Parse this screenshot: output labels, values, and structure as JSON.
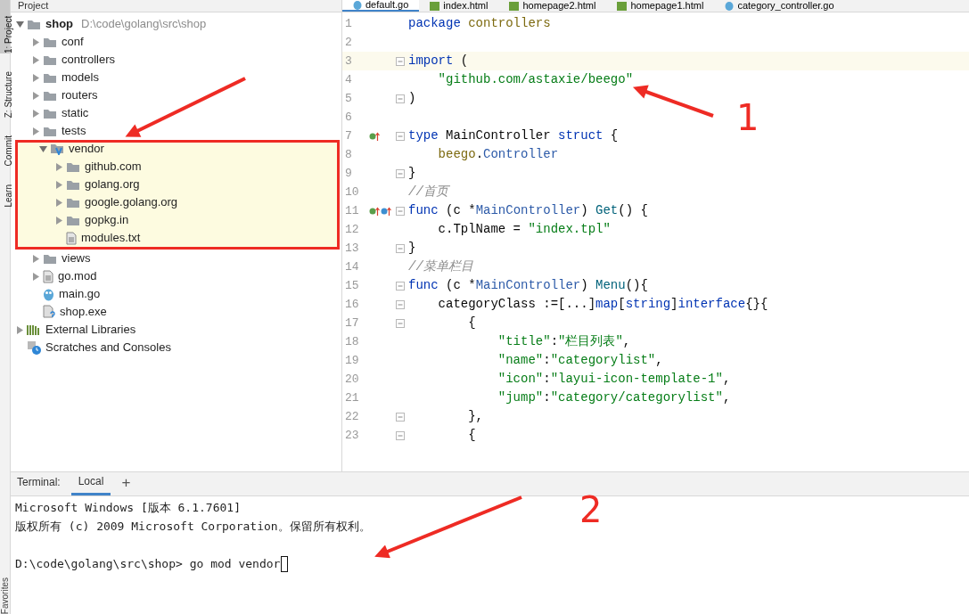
{
  "side_strip": [
    {
      "label": "1: Project",
      "selected": true
    },
    {
      "label": "Z: Structure",
      "selected": false
    },
    {
      "label": "Commit",
      "selected": false
    },
    {
      "label": "Learn",
      "selected": false
    }
  ],
  "bottom_strip": [
    {
      "label": "Favorites"
    }
  ],
  "project_panel": {
    "title": "Project"
  },
  "tree": [
    {
      "kind": "folder",
      "label": "shop",
      "path": "D:\\code\\golang\\src\\shop",
      "expanded": true,
      "children": [
        {
          "kind": "folder",
          "label": "conf",
          "expanded": false
        },
        {
          "kind": "folder",
          "label": "controllers",
          "expanded": false
        },
        {
          "kind": "folder",
          "label": "models",
          "expanded": false
        },
        {
          "kind": "folder",
          "label": "routers",
          "expanded": false
        },
        {
          "kind": "folder",
          "label": "static",
          "expanded": false
        },
        {
          "kind": "folder",
          "label": "tests",
          "expanded": false
        },
        {
          "kind": "vendor",
          "label": "vendor",
          "expanded": true,
          "annotated": true,
          "children": [
            {
              "kind": "folder",
              "label": "github.com",
              "expanded": false
            },
            {
              "kind": "folder",
              "label": "golang.org",
              "expanded": false
            },
            {
              "kind": "folder",
              "label": "google.golang.org",
              "expanded": false
            },
            {
              "kind": "folder",
              "label": "gopkg.in",
              "expanded": false
            },
            {
              "kind": "text",
              "label": "modules.txt"
            }
          ]
        },
        {
          "kind": "folder",
          "label": "views",
          "expanded": false
        },
        {
          "kind": "text",
          "label": "go.mod",
          "expanded": false
        },
        {
          "kind": "go",
          "label": "main.go"
        },
        {
          "kind": "exe",
          "label": "shop.exe"
        }
      ]
    },
    {
      "kind": "library",
      "label": "External Libraries",
      "expanded": false
    },
    {
      "kind": "scratch",
      "label": "Scratches and Consoles"
    }
  ],
  "editor_tabs": [
    {
      "kind": "go",
      "label": "default.go",
      "selected": true
    },
    {
      "kind": "html",
      "label": "index.html",
      "selected": false
    },
    {
      "kind": "html",
      "label": "homepage2.html",
      "selected": false
    },
    {
      "kind": "html",
      "label": "homepage1.html",
      "selected": false
    },
    {
      "kind": "go",
      "label": "category_controller.go",
      "selected": false
    }
  ],
  "code": [
    {
      "n": "1",
      "tokens": [
        {
          "kind": "kw",
          "text": "package"
        },
        {
          "kind": "pkg",
          "text": " controllers"
        }
      ]
    },
    {
      "n": "2"
    },
    {
      "n": "3",
      "current": true,
      "fold": true,
      "tokens": [
        {
          "kind": "kw",
          "text": "import"
        },
        {
          "kind": "plain",
          "text": " ("
        }
      ]
    },
    {
      "n": "4",
      "tokens": [
        {
          "kind": "str",
          "text": "    \"github.com/astaxie/beego\""
        }
      ]
    },
    {
      "n": "5",
      "fold": true,
      "tokens": [
        {
          "kind": "plain",
          "text": ")"
        }
      ]
    },
    {
      "n": "6"
    },
    {
      "n": "7",
      "fold": true,
      "gutter": [
        {
          "kind": "implemented"
        }
      ],
      "tokens": [
        {
          "kind": "kw",
          "text": "type"
        },
        {
          "kind": "plain",
          "text": " MainController "
        },
        {
          "kind": "kw",
          "text": "struct"
        },
        {
          "kind": "plain",
          "text": " {"
        }
      ]
    },
    {
      "n": "8",
      "tokens": [
        {
          "kind": "pkg",
          "text": "    beego"
        },
        {
          "kind": "plain",
          "text": "."
        },
        {
          "kind": "type",
          "text": "Controller"
        }
      ]
    },
    {
      "n": "9",
      "fold": true,
      "tokens": [
        {
          "kind": "plain",
          "text": "}"
        }
      ]
    },
    {
      "n": "10",
      "tokens": [
        {
          "kind": "comment",
          "text": "//首页"
        }
      ]
    },
    {
      "n": "11",
      "fold": true,
      "gutter": [
        {
          "kind": "implemented"
        },
        {
          "kind": "implementing"
        }
      ],
      "tokens": [
        {
          "kind": "kw",
          "text": "func"
        },
        {
          "kind": "plain",
          "text": " (c *"
        },
        {
          "kind": "type",
          "text": "MainController"
        },
        {
          "kind": "plain",
          "text": ") "
        },
        {
          "kind": "fn",
          "text": "Get"
        },
        {
          "kind": "plain",
          "text": "() {"
        }
      ]
    },
    {
      "n": "12",
      "tokens": [
        {
          "kind": "plain",
          "text": "    c.TplName = "
        },
        {
          "kind": "str",
          "text": "\"index.tpl\""
        }
      ]
    },
    {
      "n": "13",
      "fold": true,
      "tokens": [
        {
          "kind": "plain",
          "text": "}"
        }
      ]
    },
    {
      "n": "14",
      "tokens": [
        {
          "kind": "comment",
          "text": "//菜单栏目"
        }
      ]
    },
    {
      "n": "15",
      "fold": true,
      "tokens": [
        {
          "kind": "kw",
          "text": "func"
        },
        {
          "kind": "plain",
          "text": " (c *"
        },
        {
          "kind": "type",
          "text": "MainController"
        },
        {
          "kind": "plain",
          "text": ") "
        },
        {
          "kind": "fn",
          "text": "Menu"
        },
        {
          "kind": "plain",
          "text": "(){"
        }
      ]
    },
    {
      "n": "16",
      "fold": true,
      "tokens": [
        {
          "kind": "plain",
          "text": "    categoryClass :=[...]"
        },
        {
          "kind": "kw",
          "text": "map"
        },
        {
          "kind": "plain",
          "text": "["
        },
        {
          "kind": "kw",
          "text": "string"
        },
        {
          "kind": "plain",
          "text": "]"
        },
        {
          "kind": "kw",
          "text": "interface"
        },
        {
          "kind": "plain",
          "text": "{}{"
        }
      ]
    },
    {
      "n": "17",
      "fold": true,
      "tokens": [
        {
          "kind": "plain",
          "text": "        {"
        }
      ]
    },
    {
      "n": "18",
      "tokens": [
        {
          "kind": "str",
          "text": "            \"title\""
        },
        {
          "kind": "plain",
          "text": ":"
        },
        {
          "kind": "str",
          "text": "\"栏目列表\""
        },
        {
          "kind": "plain",
          "text": ","
        }
      ]
    },
    {
      "n": "19",
      "tokens": [
        {
          "kind": "str",
          "text": "            \"name\""
        },
        {
          "kind": "plain",
          "text": ":"
        },
        {
          "kind": "str",
          "text": "\"categorylist\""
        },
        {
          "kind": "plain",
          "text": ","
        }
      ]
    },
    {
      "n": "20",
      "tokens": [
        {
          "kind": "str",
          "text": "            \"icon\""
        },
        {
          "kind": "plain",
          "text": ":"
        },
        {
          "kind": "str",
          "text": "\"layui-icon-template-1\""
        },
        {
          "kind": "plain",
          "text": ","
        }
      ]
    },
    {
      "n": "21",
      "tokens": [
        {
          "kind": "str",
          "text": "            \"jump\""
        },
        {
          "kind": "plain",
          "text": ":"
        },
        {
          "kind": "str",
          "text": "\"category/categorylist\""
        },
        {
          "kind": "plain",
          "text": ","
        }
      ]
    },
    {
      "n": "22",
      "fold": true,
      "tokens": [
        {
          "kind": "plain",
          "text": "        },"
        }
      ]
    },
    {
      "n": "23",
      "fold": true,
      "tokens": [
        {
          "kind": "plain",
          "text": "        {"
        }
      ]
    }
  ],
  "terminal": {
    "title": "Terminal:",
    "tabs": [
      {
        "label": "Local",
        "selected": true
      }
    ],
    "add": "+",
    "lines": [
      {
        "text": "Microsoft Windows [版本 6.1.7601]"
      },
      {
        "text": "版权所有 (c) 2009 Microsoft Corporation。保留所有权利。"
      },
      {
        "text": "D:\\code\\golang\\src\\shop> go mod vendor",
        "gap_before": true,
        "cursor": true
      }
    ]
  },
  "annotations": [
    {
      "label": "1"
    },
    {
      "label": "2"
    }
  ]
}
